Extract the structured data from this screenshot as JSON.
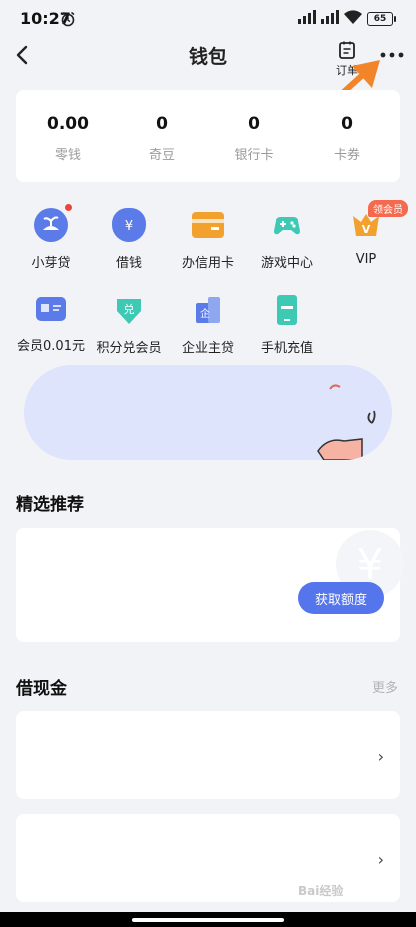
{
  "status_bar": {
    "time": "10:27",
    "battery": "65"
  },
  "header": {
    "title": "钱包",
    "orders_label": "订单"
  },
  "balances": [
    {
      "value": "0.00",
      "label": "零钱"
    },
    {
      "value": "0",
      "label": "奇豆"
    },
    {
      "value": "0",
      "label": "银行卡"
    },
    {
      "value": "0",
      "label": "卡券"
    }
  ],
  "services_row1": [
    {
      "label": "小芽贷",
      "icon": "sprout-icon"
    },
    {
      "label": "借钱",
      "icon": "money-bag-icon"
    },
    {
      "label": "办信用卡",
      "icon": "credit-card-icon"
    },
    {
      "label": "游戏中心",
      "icon": "gamepad-icon"
    },
    {
      "label": "VIP",
      "icon": "vip-crown-icon",
      "badge": "领会员"
    }
  ],
  "services_row2": [
    {
      "label": "会员0.01元",
      "icon": "membership-card-icon"
    },
    {
      "label": "积分兑会员",
      "icon": "redeem-icon",
      "glyph": "兑"
    },
    {
      "label": "企业主贷",
      "icon": "enterprise-icon",
      "glyph": "企"
    },
    {
      "label": "手机充值",
      "icon": "phone-recharge-icon"
    }
  ],
  "recommend": {
    "title": "精选推荐",
    "button": "获取额度"
  },
  "cash": {
    "title": "借现金",
    "more": "更多"
  },
  "watermark": "Bai经验",
  "colors": {
    "accent": "#5575ec",
    "teal": "#3ec9b4",
    "orange": "#f2a12e",
    "badge": "#f56a4e"
  }
}
